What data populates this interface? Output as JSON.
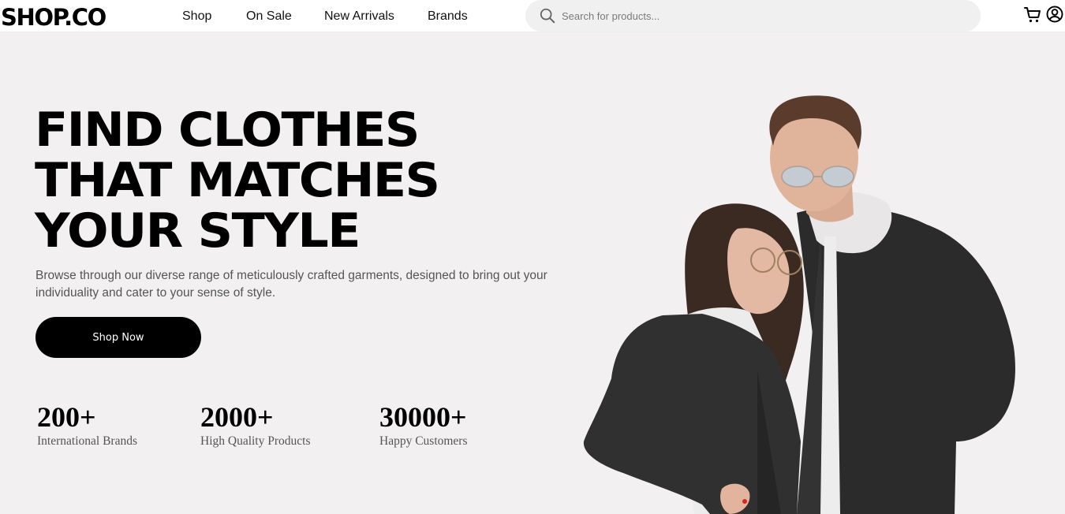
{
  "header": {
    "logo": "SHOP.CO",
    "nav": [
      {
        "label": "Shop"
      },
      {
        "label": "On Sale"
      },
      {
        "label": "New Arrivals"
      },
      {
        "label": "Brands"
      }
    ],
    "search": {
      "placeholder": "Search for products...",
      "icon": "search-icon"
    },
    "icons": [
      "cart-icon",
      "user-icon"
    ]
  },
  "hero": {
    "headline": [
      "FIND CLOTHES",
      "THAT MATCHES",
      "YOUR STYLE"
    ],
    "subtext": "Browse through our diverse range of meticulously crafted garments, designed to bring out your individuality and cater to your sense of style.",
    "cta_label": "Shop Now",
    "stats": [
      {
        "value": "200+",
        "label": "International Brands"
      },
      {
        "value": "2000+",
        "label": "High Quality Products"
      },
      {
        "value": "30000+",
        "label": "Happy Customers"
      }
    ]
  },
  "colors": {
    "background": "#f2f0f1",
    "header_bg": "#ffffff",
    "search_bg": "#f0f0f0",
    "button_bg": "#000000",
    "button_text": "#ffffff",
    "text_muted": "#555555"
  }
}
